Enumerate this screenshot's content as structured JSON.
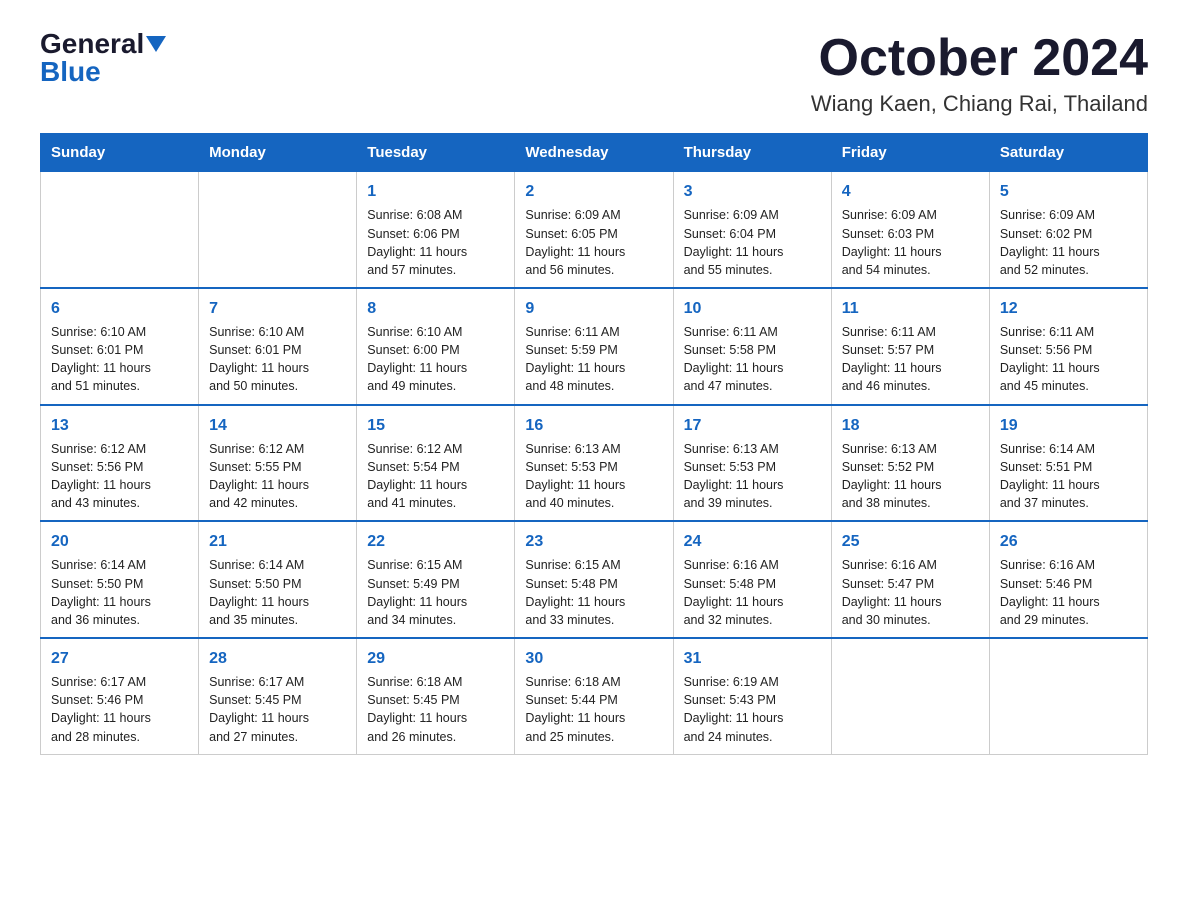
{
  "header": {
    "logo_general": "General",
    "logo_blue": "Blue",
    "month_title": "October 2024",
    "location": "Wiang Kaen, Chiang Rai, Thailand"
  },
  "calendar": {
    "days_of_week": [
      "Sunday",
      "Monday",
      "Tuesday",
      "Wednesday",
      "Thursday",
      "Friday",
      "Saturday"
    ],
    "weeks": [
      [
        {
          "day": "",
          "info": ""
        },
        {
          "day": "",
          "info": ""
        },
        {
          "day": "1",
          "info": "Sunrise: 6:08 AM\nSunset: 6:06 PM\nDaylight: 11 hours\nand 57 minutes."
        },
        {
          "day": "2",
          "info": "Sunrise: 6:09 AM\nSunset: 6:05 PM\nDaylight: 11 hours\nand 56 minutes."
        },
        {
          "day": "3",
          "info": "Sunrise: 6:09 AM\nSunset: 6:04 PM\nDaylight: 11 hours\nand 55 minutes."
        },
        {
          "day": "4",
          "info": "Sunrise: 6:09 AM\nSunset: 6:03 PM\nDaylight: 11 hours\nand 54 minutes."
        },
        {
          "day": "5",
          "info": "Sunrise: 6:09 AM\nSunset: 6:02 PM\nDaylight: 11 hours\nand 52 minutes."
        }
      ],
      [
        {
          "day": "6",
          "info": "Sunrise: 6:10 AM\nSunset: 6:01 PM\nDaylight: 11 hours\nand 51 minutes."
        },
        {
          "day": "7",
          "info": "Sunrise: 6:10 AM\nSunset: 6:01 PM\nDaylight: 11 hours\nand 50 minutes."
        },
        {
          "day": "8",
          "info": "Sunrise: 6:10 AM\nSunset: 6:00 PM\nDaylight: 11 hours\nand 49 minutes."
        },
        {
          "day": "9",
          "info": "Sunrise: 6:11 AM\nSunset: 5:59 PM\nDaylight: 11 hours\nand 48 minutes."
        },
        {
          "day": "10",
          "info": "Sunrise: 6:11 AM\nSunset: 5:58 PM\nDaylight: 11 hours\nand 47 minutes."
        },
        {
          "day": "11",
          "info": "Sunrise: 6:11 AM\nSunset: 5:57 PM\nDaylight: 11 hours\nand 46 minutes."
        },
        {
          "day": "12",
          "info": "Sunrise: 6:11 AM\nSunset: 5:56 PM\nDaylight: 11 hours\nand 45 minutes."
        }
      ],
      [
        {
          "day": "13",
          "info": "Sunrise: 6:12 AM\nSunset: 5:56 PM\nDaylight: 11 hours\nand 43 minutes."
        },
        {
          "day": "14",
          "info": "Sunrise: 6:12 AM\nSunset: 5:55 PM\nDaylight: 11 hours\nand 42 minutes."
        },
        {
          "day": "15",
          "info": "Sunrise: 6:12 AM\nSunset: 5:54 PM\nDaylight: 11 hours\nand 41 minutes."
        },
        {
          "day": "16",
          "info": "Sunrise: 6:13 AM\nSunset: 5:53 PM\nDaylight: 11 hours\nand 40 minutes."
        },
        {
          "day": "17",
          "info": "Sunrise: 6:13 AM\nSunset: 5:53 PM\nDaylight: 11 hours\nand 39 minutes."
        },
        {
          "day": "18",
          "info": "Sunrise: 6:13 AM\nSunset: 5:52 PM\nDaylight: 11 hours\nand 38 minutes."
        },
        {
          "day": "19",
          "info": "Sunrise: 6:14 AM\nSunset: 5:51 PM\nDaylight: 11 hours\nand 37 minutes."
        }
      ],
      [
        {
          "day": "20",
          "info": "Sunrise: 6:14 AM\nSunset: 5:50 PM\nDaylight: 11 hours\nand 36 minutes."
        },
        {
          "day": "21",
          "info": "Sunrise: 6:14 AM\nSunset: 5:50 PM\nDaylight: 11 hours\nand 35 minutes."
        },
        {
          "day": "22",
          "info": "Sunrise: 6:15 AM\nSunset: 5:49 PM\nDaylight: 11 hours\nand 34 minutes."
        },
        {
          "day": "23",
          "info": "Sunrise: 6:15 AM\nSunset: 5:48 PM\nDaylight: 11 hours\nand 33 minutes."
        },
        {
          "day": "24",
          "info": "Sunrise: 6:16 AM\nSunset: 5:48 PM\nDaylight: 11 hours\nand 32 minutes."
        },
        {
          "day": "25",
          "info": "Sunrise: 6:16 AM\nSunset: 5:47 PM\nDaylight: 11 hours\nand 30 minutes."
        },
        {
          "day": "26",
          "info": "Sunrise: 6:16 AM\nSunset: 5:46 PM\nDaylight: 11 hours\nand 29 minutes."
        }
      ],
      [
        {
          "day": "27",
          "info": "Sunrise: 6:17 AM\nSunset: 5:46 PM\nDaylight: 11 hours\nand 28 minutes."
        },
        {
          "day": "28",
          "info": "Sunrise: 6:17 AM\nSunset: 5:45 PM\nDaylight: 11 hours\nand 27 minutes."
        },
        {
          "day": "29",
          "info": "Sunrise: 6:18 AM\nSunset: 5:45 PM\nDaylight: 11 hours\nand 26 minutes."
        },
        {
          "day": "30",
          "info": "Sunrise: 6:18 AM\nSunset: 5:44 PM\nDaylight: 11 hours\nand 25 minutes."
        },
        {
          "day": "31",
          "info": "Sunrise: 6:19 AM\nSunset: 5:43 PM\nDaylight: 11 hours\nand 24 minutes."
        },
        {
          "day": "",
          "info": ""
        },
        {
          "day": "",
          "info": ""
        }
      ]
    ]
  }
}
